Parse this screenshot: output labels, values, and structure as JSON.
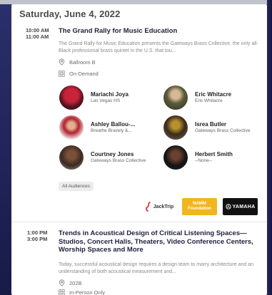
{
  "date_heading": "Saturday, June 4, 2022",
  "sessions": [
    {
      "start": "10:00 AM",
      "end": "11:00 AM",
      "title": "The Grand Rally for Music Education",
      "description": "The Grand Rally for Music Education presents the Gateways Brass Collective, the only all-Black professional brass quintet in the U.S. that tou...",
      "location": "Ballroom B",
      "format": "On-Demand",
      "speakers": [
        {
          "name": "Mariachi Joya",
          "org": "Las Vegas HS"
        },
        {
          "name": "Eric Whitacre",
          "org": "Eric Whitacre"
        },
        {
          "name": "Ashley Ballou-...",
          "org": "Breathe Bravely &..."
        },
        {
          "name": "Isrea Butler",
          "org": "Gateways Brass Collective"
        },
        {
          "name": "Courtney Jones",
          "org": "Gateways Brass Collective"
        },
        {
          "name": "Herbert Smith",
          "org": "--None--"
        }
      ],
      "audience_badge": "All Audiences",
      "sponsors": [
        {
          "name": "JackTrip",
          "icon": "jacktrip-logo",
          "color": "#e0202a"
        },
        {
          "name": "NAMM Foundation",
          "icon": "namm-logo",
          "color": "#f2b51f"
        },
        {
          "name": "YAMAHA",
          "icon": "yamaha-logo",
          "color": "#111111"
        }
      ]
    },
    {
      "start": "1:00 PM",
      "end": "3:00 PM",
      "title": "Trends in Acoustical Design of Critical Listening Spaces—Studios, Concert Halls, Theaters, Video Conference Centers, Worship Spaces and More",
      "description": "Today, successful acoustical design requires a design team to marry architecture and an understanding of both acoustical measurement and...",
      "location": "202B",
      "format": "In-Person Only"
    }
  ]
}
